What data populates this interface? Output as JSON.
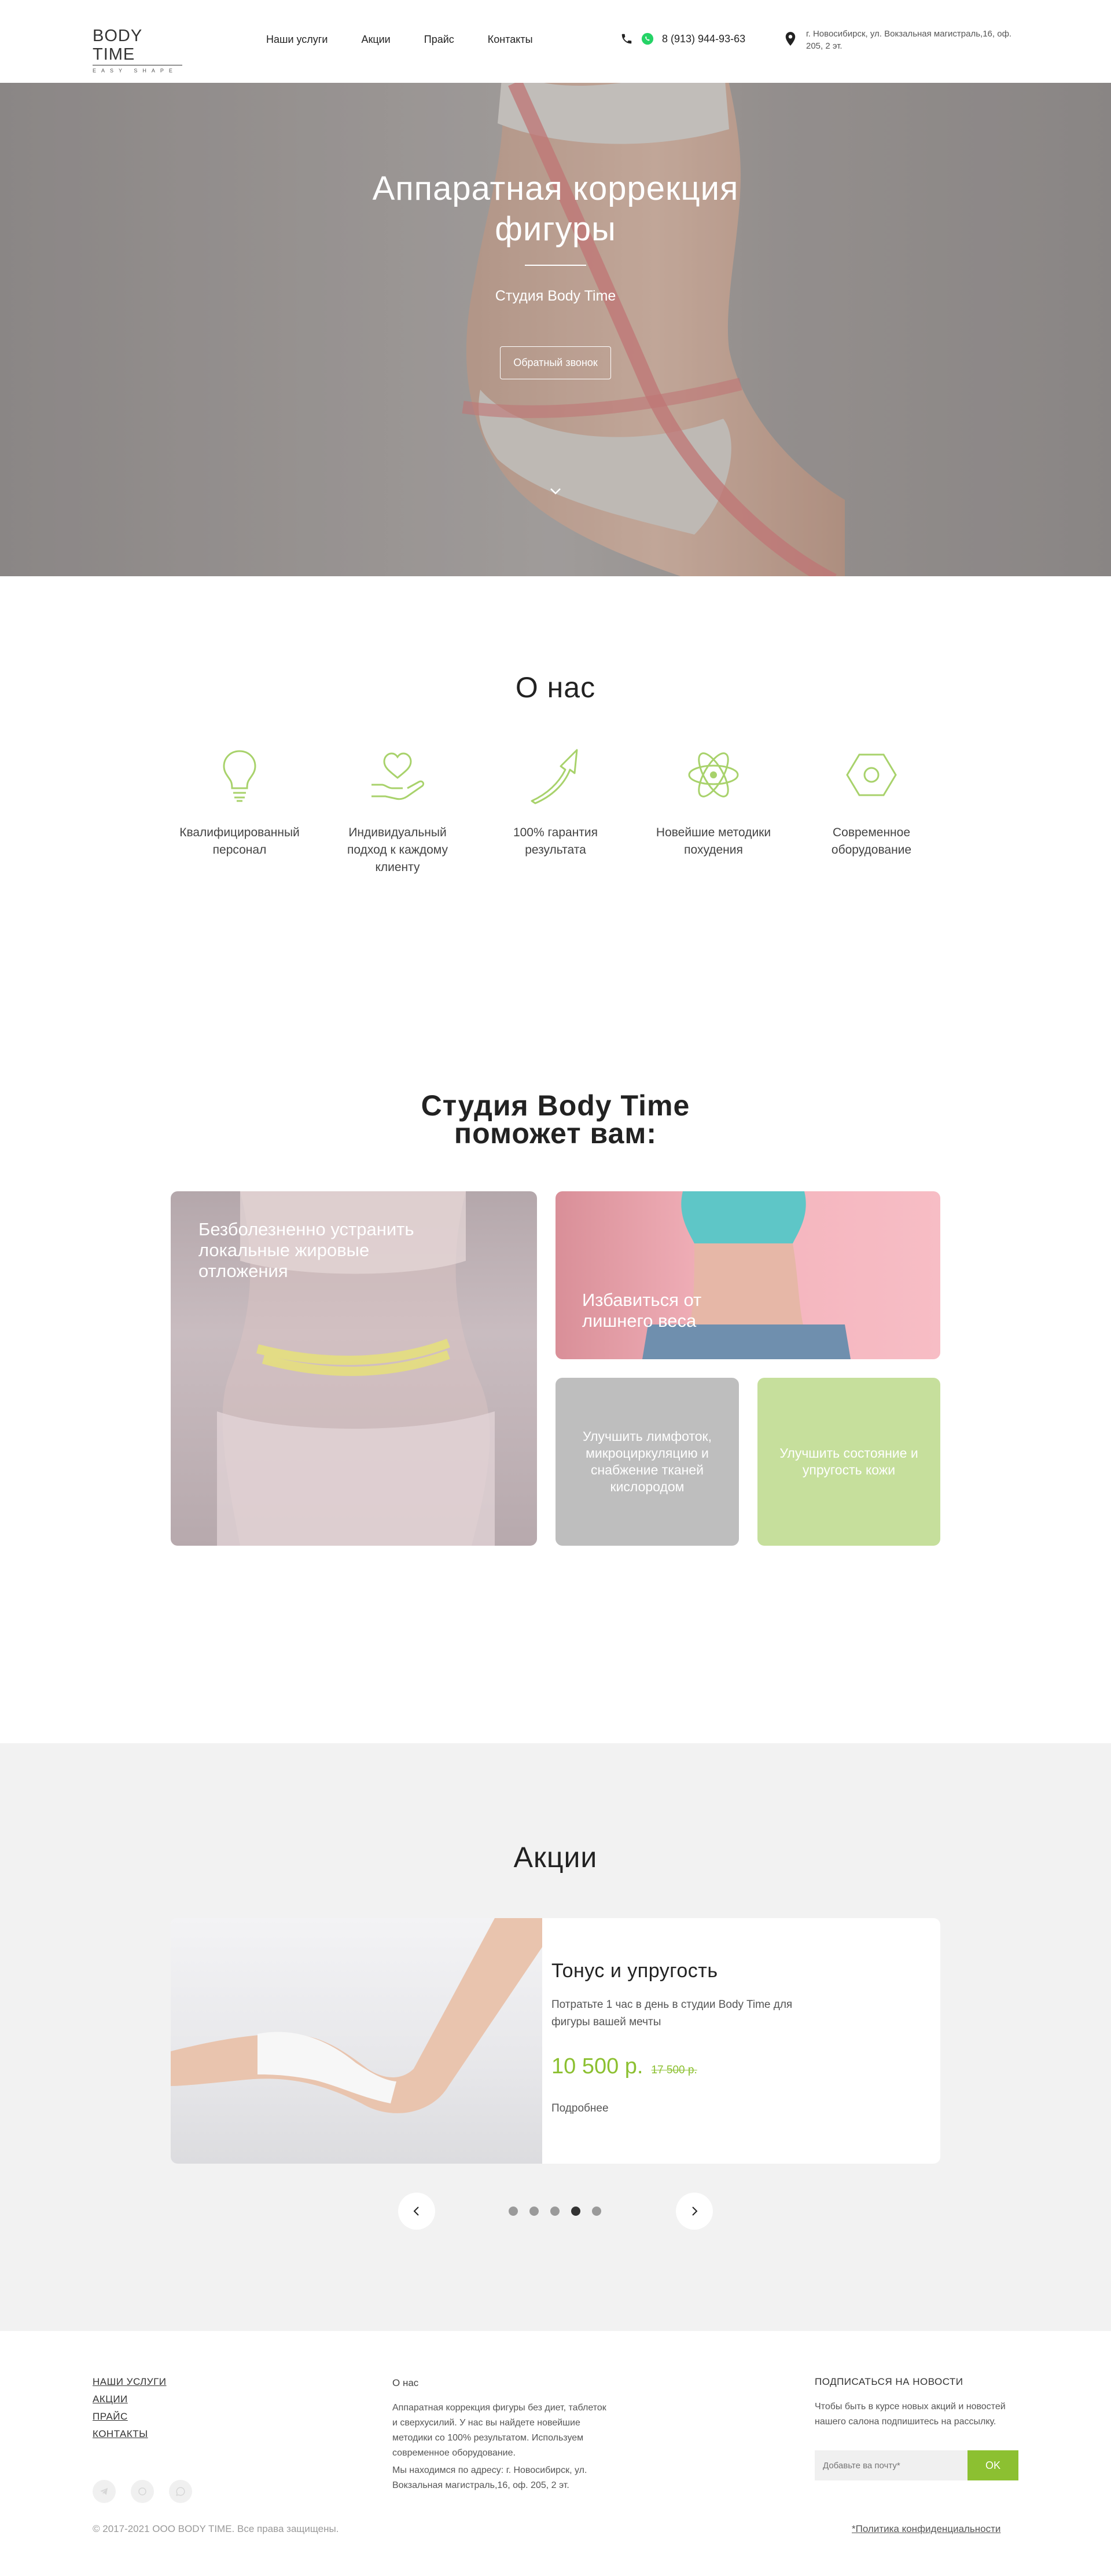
{
  "header": {
    "logo_title": "BODY TIME",
    "logo_sub": "EASY SHAPE",
    "nav": [
      "Наши услуги",
      "Акции",
      "Прайс",
      "Контакты"
    ],
    "phone": "8 (913) 944-93-63",
    "address": "г. Новосибирск, ул. Вокзальная магистраль,16, оф. 205, 2 эт."
  },
  "hero": {
    "title": "Аппаратная коррекция фигуры",
    "subtitle": "Студия Body Time",
    "button": "Обратный звонок"
  },
  "about": {
    "title": "О нас",
    "features": [
      {
        "label": "Квалифицированный персонал",
        "icon": "lightbulb-icon"
      },
      {
        "label": "Индивидуальный подход к каждому клиенту",
        "icon": "heart-hand-icon"
      },
      {
        "label": "100% гарантия результата",
        "icon": "arrow-up-icon"
      },
      {
        "label": "Новейшие методики похудения",
        "icon": "atom-icon"
      },
      {
        "label": "Современное оборудование",
        "icon": "hex-nut-icon"
      }
    ]
  },
  "help": {
    "title": "Студия Body Time поможет вам:",
    "cards": [
      "Безболезненно устранить локальные жировые отложения",
      "Избавиться от лишнего веса",
      "Улучшить лимфоток, микроциркуляцию и снабжение тканей кислородом",
      "Улучшить состояние и упругость кожи"
    ]
  },
  "promo": {
    "title": "Акции",
    "name": "Тонус и упругость",
    "description": "Потратьте 1 час в день в студии Body Time для фигуры вашей мечты",
    "price_new": "10 500 р.",
    "price_old": "17 500 р.",
    "more": "Подробнее",
    "dots_count": 5,
    "active_dot": 4
  },
  "footer": {
    "links": [
      "НАШИ УСЛУГИ",
      "АКЦИИ",
      "ПРАЙС",
      "КОНТАКТЫ"
    ],
    "about_title": "О нас",
    "about_text": "Аппаратная коррекция фигуры без диет, таблеток и сверхусилий. У нас вы найдете новейшие методики со 100% результатом. Используем современное оборудование.",
    "about_address": "Мы находимся по адресу: г. Новосибирск, ул. Вокзальная магистраль,16, оф. 205, 2 эт.",
    "subscribe_title": "ПОДПИСАТЬСЯ НА НОВОСТИ",
    "subscribe_text": "Чтобы быть в курсе новых акций и новостей нашего салона подпишитесь на рассылку.",
    "email_placeholder": "Добавьте ва почту*",
    "ok_button": "OK",
    "copyright": "© 2017-2021 ООО BODY TIME. Все права защищены.",
    "policy": "*Политика конфиденциальности"
  },
  "colors": {
    "accent_green": "#8cc031",
    "icon_green": "#a8d26b",
    "promo_bg": "#f2f2f2"
  }
}
